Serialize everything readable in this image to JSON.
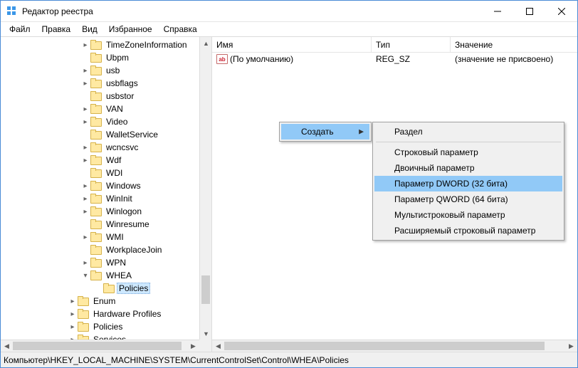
{
  "window": {
    "title": "Редактор реестра"
  },
  "menus": {
    "file": "Файл",
    "edit": "Правка",
    "view": "Вид",
    "favorites": "Избранное",
    "help": "Справка"
  },
  "tree": {
    "items": [
      {
        "indent": 112,
        "tw": ">",
        "label": "TimeZoneInformation"
      },
      {
        "indent": 112,
        "tw": "",
        "label": "Ubpm"
      },
      {
        "indent": 112,
        "tw": ">",
        "label": "usb"
      },
      {
        "indent": 112,
        "tw": ">",
        "label": "usbflags"
      },
      {
        "indent": 112,
        "tw": "",
        "label": "usbstor"
      },
      {
        "indent": 112,
        "tw": ">",
        "label": "VAN"
      },
      {
        "indent": 112,
        "tw": ">",
        "label": "Video"
      },
      {
        "indent": 112,
        "tw": "",
        "label": "WalletService"
      },
      {
        "indent": 112,
        "tw": ">",
        "label": "wcncsvc"
      },
      {
        "indent": 112,
        "tw": ">",
        "label": "Wdf"
      },
      {
        "indent": 112,
        "tw": "",
        "label": "WDI"
      },
      {
        "indent": 112,
        "tw": ">",
        "label": "Windows"
      },
      {
        "indent": 112,
        "tw": ">",
        "label": "WinInit"
      },
      {
        "indent": 112,
        "tw": ">",
        "label": "Winlogon"
      },
      {
        "indent": 112,
        "tw": "",
        "label": "Winresume"
      },
      {
        "indent": 112,
        "tw": ">",
        "label": "WMI"
      },
      {
        "indent": 112,
        "tw": "",
        "label": "WorkplaceJoin"
      },
      {
        "indent": 112,
        "tw": ">",
        "label": "WPN"
      },
      {
        "indent": 112,
        "tw": "v",
        "label": "WHEA"
      },
      {
        "indent": 130,
        "tw": "",
        "label": "Policies",
        "selected": true
      },
      {
        "indent": 94,
        "tw": ">",
        "label": "Enum"
      },
      {
        "indent": 94,
        "tw": ">",
        "label": "Hardware Profiles"
      },
      {
        "indent": 94,
        "tw": ">",
        "label": "Policies"
      },
      {
        "indent": 94,
        "tw": ">",
        "label": "Services"
      }
    ]
  },
  "list": {
    "columns": {
      "name": "Имя",
      "type": "Тип",
      "value": "Значение"
    },
    "rows": [
      {
        "icon": "ab",
        "name": "(По умолчанию)",
        "type": "REG_SZ",
        "value": "(значение не присвоено)"
      }
    ]
  },
  "status": {
    "path": "Компьютер\\HKEY_LOCAL_MACHINE\\SYSTEM\\CurrentControlSet\\Control\\WHEA\\Policies"
  },
  "context": {
    "create": "Создать",
    "submenu": {
      "section": "Раздел",
      "string": "Строковый параметр",
      "binary": "Двоичный параметр",
      "dword": "Параметр DWORD (32 бита)",
      "qword": "Параметр QWORD (64 бита)",
      "multistring": "Мультистроковый параметр",
      "expandstring": "Расширяемый строковый параметр"
    }
  }
}
